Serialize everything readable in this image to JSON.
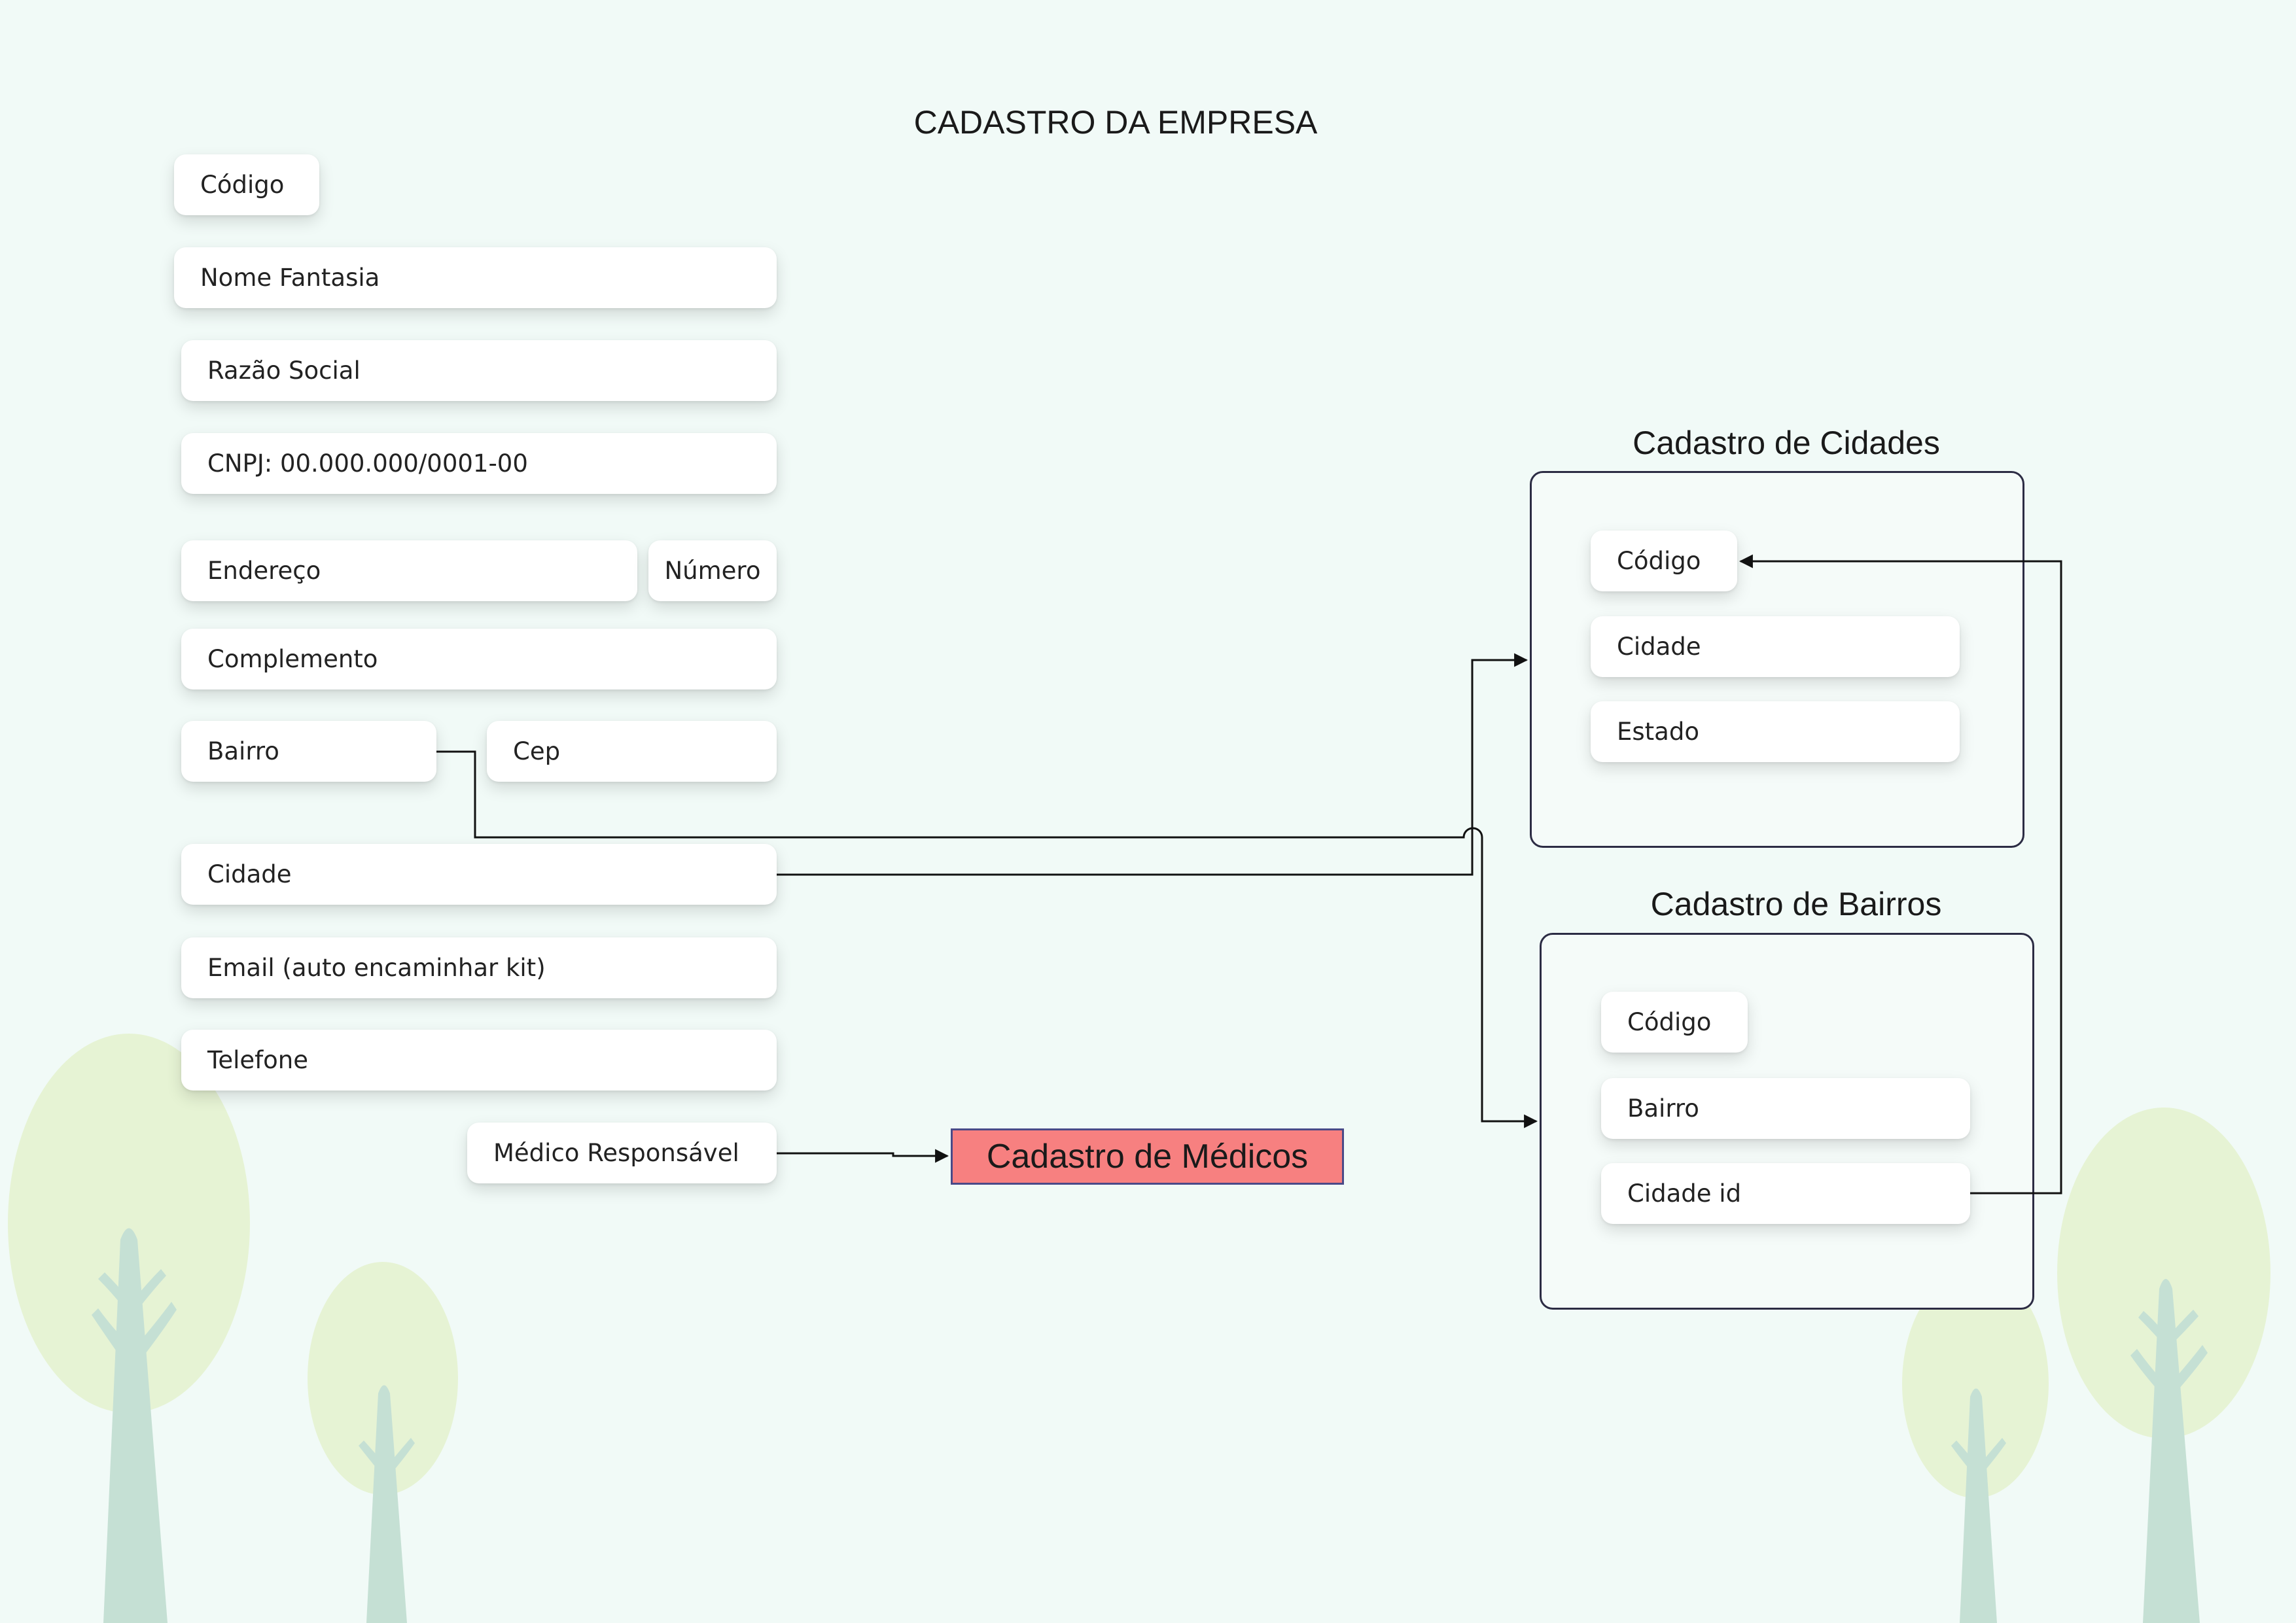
{
  "page": {
    "title": "CADASTRO DA EMPRESA"
  },
  "empresa_form": {
    "codigo": "Código",
    "nome_fantasia": "Nome Fantasia",
    "razao_social": "Razão Social",
    "cnpj": "CNPJ: 00.000.000/0001-00",
    "endereco": "Endereço",
    "numero": "Número",
    "complemento": "Complemento",
    "bairro": "Bairro",
    "cep": "Cep",
    "cidade": "Cidade",
    "email": "Email (auto encaminhar kit)",
    "telefone": "Telefone",
    "medico_responsavel": "Médico Responsável"
  },
  "cidades": {
    "title": "Cadastro de Cidades",
    "fields": {
      "codigo": "Código",
      "cidade": "Cidade",
      "estado": "Estado"
    }
  },
  "bairros": {
    "title": "Cadastro de Bairros",
    "fields": {
      "codigo": "Código",
      "bairro": "Bairro",
      "cidade_id": "Cidade id"
    }
  },
  "medicos": {
    "label": "Cadastro de Médicos"
  },
  "colors": {
    "background": "#f1faf7",
    "medicos_fill": "#f78080",
    "container_border": "#2c2c44",
    "tree_crown": "#e6f3d4",
    "tree_trunk": "#c5e0d4"
  }
}
